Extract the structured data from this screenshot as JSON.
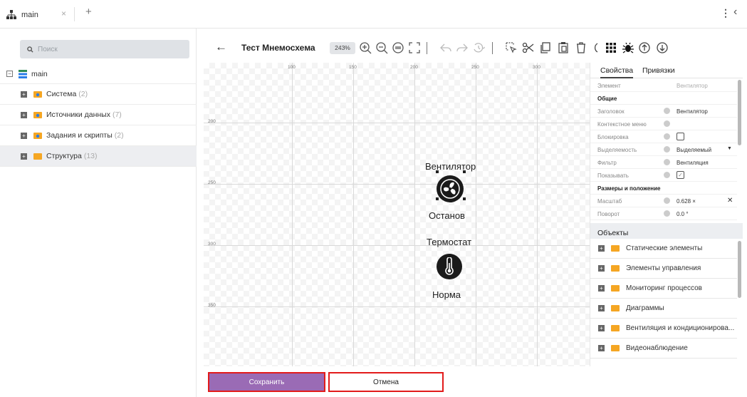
{
  "tab": {
    "label": "main",
    "close": "×",
    "add": "+",
    "more": "⋮",
    "back": "‹"
  },
  "search": {
    "placeholder": "Поиск"
  },
  "tree": {
    "root": "main",
    "items": [
      {
        "label": "Система",
        "count": "(2)"
      },
      {
        "label": "Источники данных",
        "count": "(7)"
      },
      {
        "label": "Задания и скрипты",
        "count": "(2)"
      },
      {
        "label": "Структура",
        "count": "(13)"
      }
    ]
  },
  "toolbar": {
    "back": "←",
    "title": "Тест Мнемосхема",
    "zoom": "243%"
  },
  "canvas": {
    "ruler_x": [
      "100",
      "150",
      "200",
      "250",
      "300"
    ],
    "ruler_y": [
      "200",
      "250",
      "300",
      "350"
    ],
    "fan": {
      "title": "Вентилятор",
      "status": "Останов"
    },
    "thermo": {
      "title": "Термостат",
      "status": "Норма"
    }
  },
  "props": {
    "tabs": [
      "Свойства",
      "Привязки"
    ],
    "element_key": "Элемент",
    "element_val": "Вентилятор",
    "section_general": "Общие",
    "rows": [
      {
        "k": "Заголовок",
        "v": "Вентилятор"
      },
      {
        "k": "Контекстное меню",
        "v": ""
      },
      {
        "k": "Блокировка",
        "v": ""
      },
      {
        "k": "Выделяемость",
        "v": "Выделяемый"
      },
      {
        "k": "Фильтр",
        "v": "Вентиляция"
      },
      {
        "k": "Показывать",
        "v": "✓"
      }
    ],
    "section_size": "Размеры и положение",
    "rows2": [
      {
        "k": "Масштаб",
        "v": "0.628 ×"
      },
      {
        "k": "Поворот",
        "v": "0.0 °"
      }
    ],
    "clear": "✕"
  },
  "objects": {
    "title": "Объекты",
    "items": [
      "Статические элементы",
      "Элементы управления",
      "Мониторинг процессов",
      "Диаграммы",
      "Вентиляция и кондиционирова...",
      "Видеонаблюдение"
    ]
  },
  "buttons": {
    "save": "Сохранить",
    "cancel": "Отмена"
  },
  "colors": {
    "accent": "#9a6bb5",
    "highlight": "#e21b1b",
    "folder": "#f5a623"
  }
}
